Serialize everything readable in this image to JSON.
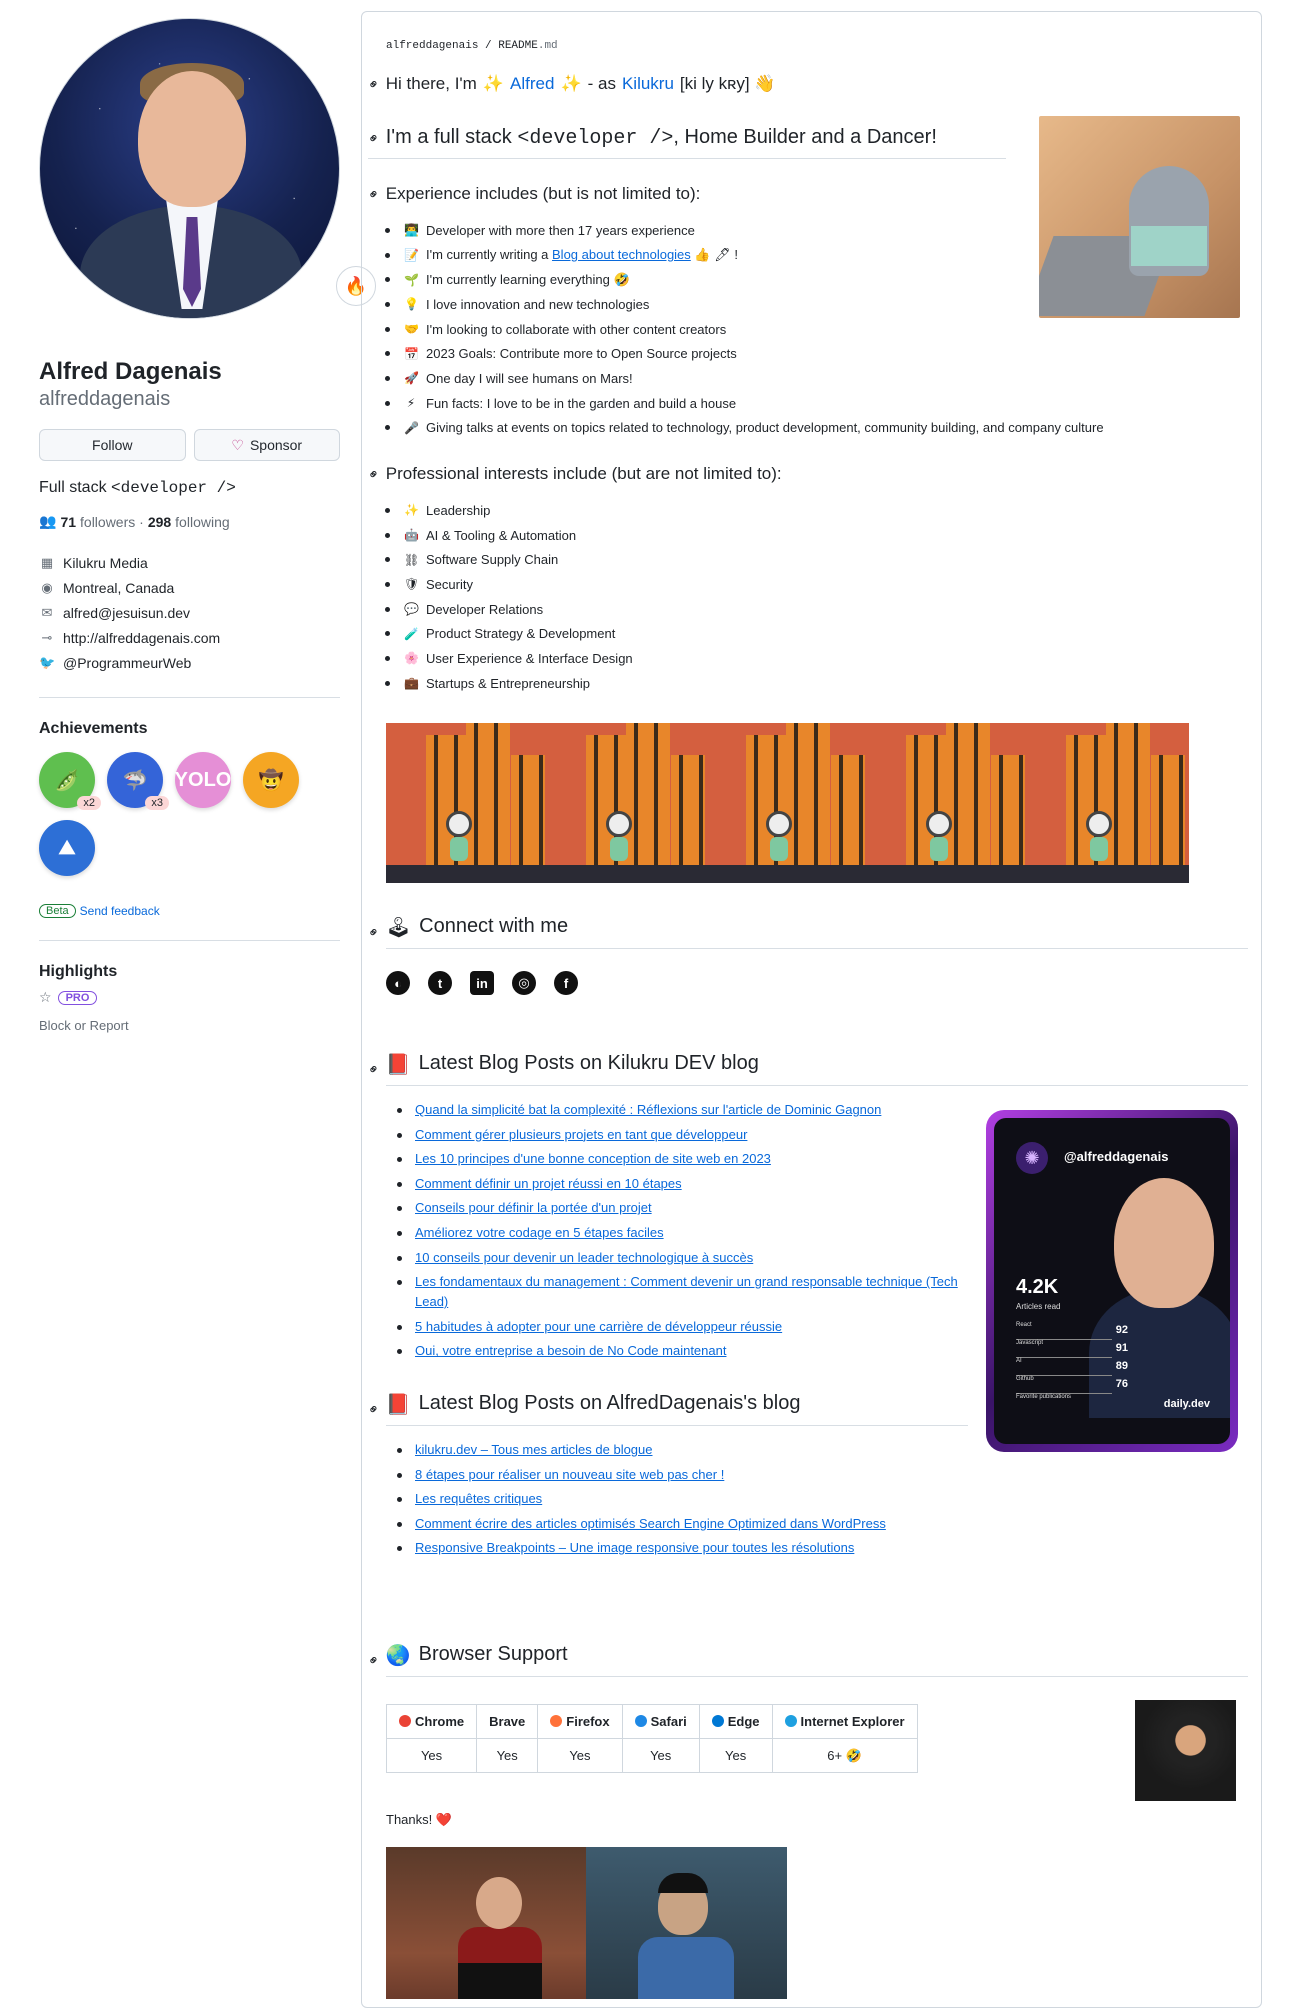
{
  "profile": {
    "name": "Alfred Dagenais",
    "login": "alfreddagenais",
    "follow_label": "Follow",
    "sponsor_label": "Sponsor",
    "bio_prefix": "Full stack ",
    "bio_code": "<developer />",
    "followers_count": "71",
    "followers_label": " followers · ",
    "following_count": "298",
    "following_label": " following",
    "details": [
      {
        "icon": "building-icon",
        "glyph": "▦",
        "text": "Kilukru Media"
      },
      {
        "icon": "location-icon",
        "glyph": "◉",
        "text": "Montreal, Canada"
      },
      {
        "icon": "mail-icon",
        "glyph": "✉",
        "text": "alfred@jesuisun.dev"
      },
      {
        "icon": "link-icon",
        "glyph": "⊸",
        "text": "http://alfreddagenais.com"
      },
      {
        "icon": "twitter-icon",
        "glyph": "🐦",
        "text": "@ProgrammeurWeb"
      }
    ],
    "achievements_title": "Achievements",
    "achievements": [
      {
        "icon": "pair-extraordinaire-icon",
        "glyph": "🫛",
        "count": "x2",
        "color": "#5fbf4f"
      },
      {
        "icon": "pull-shark-icon",
        "glyph": "🦈",
        "count": "x3",
        "color": "#3464d8"
      },
      {
        "icon": "yolo-icon",
        "glyph": "YOLO",
        "count": "",
        "color": "#e58fd6"
      },
      {
        "icon": "quickdraw-icon",
        "glyph": "🤠",
        "count": "",
        "color": "#f5a623"
      },
      {
        "icon": "arctic-code-vault-icon",
        "glyph": "⛰",
        "count": "",
        "color": "#2d6fd6"
      }
    ],
    "beta_label": "Beta",
    "feedback_label": "Send feedback",
    "highlights_title": "Highlights",
    "pro_label": "PRO",
    "block_label": "Block or Report"
  },
  "readme": {
    "path_user": "alfreddagenais",
    "path_sep": " / ",
    "path_file": "README",
    "path_ext": ".md",
    "hi_prefix": "Hi there, I'm ",
    "hi_name": "Alfred",
    "hi_mid": " - as ",
    "hi_alias": "Kilukru",
    "hi_suffix": " [ki ly kʀy] 👋",
    "fullstack_prefix": "I'm a full stack ",
    "fullstack_code": "<developer />",
    "fullstack_suffix": ", Home Builder and a Dancer!",
    "experience_title": "Experience includes (but is not limited to):",
    "experience": [
      {
        "emoji": "👨‍💻",
        "text": "Developer with more then 17 years experience",
        "link": ""
      },
      {
        "emoji": "📝",
        "text": "I'm currently writing a ",
        "link": "Blog about technologies",
        "after": " 👍 🖊 !"
      },
      {
        "emoji": "🌱",
        "text": "I'm currently learning everything 🤣",
        "link": ""
      },
      {
        "emoji": "💡",
        "text": "I love innovation and new technologies",
        "link": ""
      },
      {
        "emoji": "🤝",
        "text": "I'm looking to collaborate with other content creators",
        "link": ""
      },
      {
        "emoji": "📅",
        "text": "2023 Goals: Contribute more to Open Source projects",
        "link": ""
      },
      {
        "emoji": "🚀",
        "text": "One day I will see humans on Mars!",
        "link": ""
      },
      {
        "emoji": "⚡",
        "text": "Fun facts: I love to be in the garden and build a house",
        "link": ""
      },
      {
        "emoji": "🎤",
        "text": "Giving talks at events on topics related to technology, product development, community building, and company culture",
        "link": ""
      }
    ],
    "interests_title": "Professional interests include (but are not limited to):",
    "interests": [
      {
        "emoji": "✨",
        "text": "Leadership"
      },
      {
        "emoji": "🤖",
        "text": "AI & Tooling & Automation"
      },
      {
        "emoji": "⛓",
        "text": "Software Supply Chain"
      },
      {
        "emoji": "🛡",
        "text": "Security"
      },
      {
        "emoji": "💬",
        "text": "Developer Relations"
      },
      {
        "emoji": "🧪",
        "text": "Product Strategy & Development"
      },
      {
        "emoji": "🌸",
        "text": "User Experience & Interface Design"
      },
      {
        "emoji": "💼",
        "text": "Startups & Entrepreneurship"
      }
    ],
    "connect_title": "Connect with me",
    "social": [
      {
        "icon": "website-icon",
        "glyph": "◐"
      },
      {
        "icon": "twitter-icon",
        "glyph": "t"
      },
      {
        "icon": "linkedin-icon",
        "glyph": "in"
      },
      {
        "icon": "instagram-icon",
        "glyph": "◎"
      },
      {
        "icon": "facebook-icon",
        "glyph": "f"
      }
    ],
    "dev_blog_title": "Latest Blog Posts on Kilukru DEV blog",
    "dev_posts": [
      "Quand la simplicité bat la complexité : Réflexions sur l'article de Dominic Gagnon",
      "Comment gérer plusieurs projets en tant que développeur",
      "Les 10 principes d'une bonne conception de site web en 2023",
      "Comment définir un projet réussi en 10 étapes",
      "Conseils pour définir la portée d'un projet",
      "Améliorez votre codage en 5 étapes faciles",
      "10 conseils pour devenir un leader technologique à succès",
      "Les fondamentaux du management : Comment devenir un grand responsable technique (Tech Lead)",
      "5 habitudes à adopter pour une carrière de développeur réussie",
      "Oui, votre entreprise a besoin de No Code maintenant"
    ],
    "personal_blog_title": "Latest Blog Posts on AlfredDagenais's blog",
    "personal_posts": [
      "kilukru.dev – Tous mes articles de blogue",
      "8 étapes pour réaliser un nouveau site web pas cher !",
      "Les requêtes critiques",
      "Comment écrire des articles optimisés Search Engine Optimized dans WordPress",
      "Responsive Breakpoints – Une image responsive pour toutes les résolutions"
    ],
    "daily_card": {
      "handle": "@alfreddagenais",
      "articles_count": "4.2K",
      "articles_label": "Articles read",
      "stats": [
        {
          "label": "React",
          "value": "92"
        },
        {
          "label": "Javascript",
          "value": "91"
        },
        {
          "label": "AI",
          "value": "89"
        },
        {
          "label": "Github",
          "value": "76"
        }
      ],
      "favorites_label": "Favorite publications",
      "brand": "daily.dev"
    },
    "browser_title": "Browser Support",
    "browsers": [
      {
        "name": "Chrome",
        "support": "Yes",
        "color": "#ea4335"
      },
      {
        "name": "Brave",
        "support": "Yes",
        "color": ""
      },
      {
        "name": "Firefox",
        "support": "Yes",
        "color": "#ff7139"
      },
      {
        "name": "Safari",
        "support": "Yes",
        "color": "#1e88e5"
      },
      {
        "name": "Edge",
        "support": "Yes",
        "color": "#0078d4"
      },
      {
        "name": "Internet Explorer",
        "support": "6+ 🤣",
        "color": "#1ea0e0"
      }
    ],
    "thanks_label": "Thanks! ❤️"
  },
  "colors": {
    "link": "#0969da",
    "banner_bg": "#d45f3f",
    "building": "#e8862a",
    "card_border": "#b23fe3"
  }
}
